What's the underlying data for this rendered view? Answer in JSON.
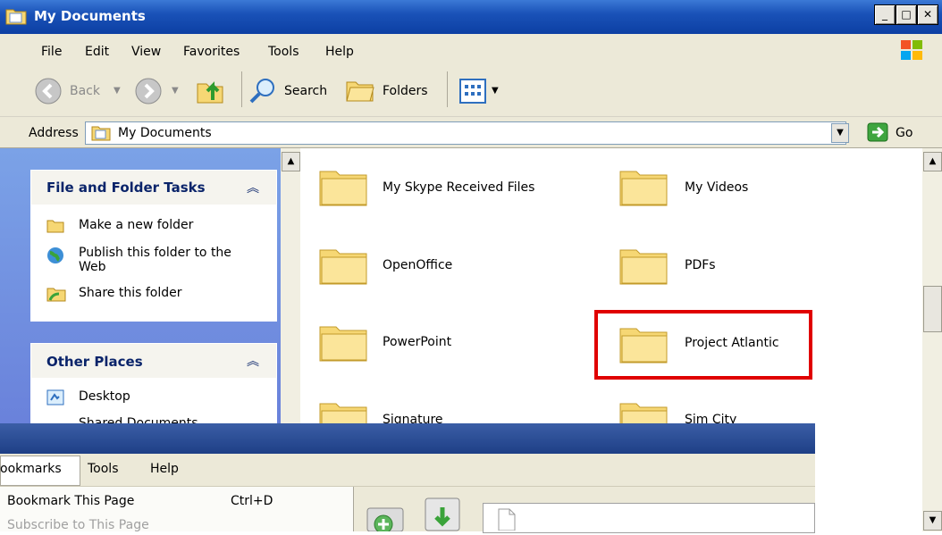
{
  "window": {
    "title": "My Documents",
    "minimize": "_",
    "maximize": "□",
    "close": "✕"
  },
  "menu": [
    "File",
    "Edit",
    "View",
    "Favorites",
    "Tools",
    "Help"
  ],
  "toolbar": {
    "back": "Back",
    "search": "Search",
    "folders": "Folders"
  },
  "address": {
    "label": "Address",
    "value": "My Documents",
    "go": "Go"
  },
  "left": {
    "tasks_title": "File and Folder Tasks",
    "tasks": [
      "Make a new folder",
      "Publish this folder to the Web",
      "Share this folder"
    ],
    "places_title": "Other Places",
    "places": [
      "Desktop",
      "Shared Documents"
    ]
  },
  "folders": [
    {
      "name": "My Skype Received Files"
    },
    {
      "name": "My Videos"
    },
    {
      "name": "OpenOffice"
    },
    {
      "name": "PDFs"
    },
    {
      "name": "PowerPoint"
    },
    {
      "name": "Project Atlantic"
    },
    {
      "name": "Signature"
    },
    {
      "name": "Sim City"
    }
  ],
  "second_window": {
    "menu": [
      "ookmarks",
      "Tools",
      "Help"
    ],
    "dropdown": [
      {
        "label": "Bookmark This Page",
        "shortcut": "Ctrl+D"
      },
      {
        "label": "Subscribe to This Page",
        "shortcut": ""
      }
    ]
  },
  "colors": {
    "title_blue": "#0c3fa3",
    "highlight_red": "#e00000",
    "folder_yellow": "#f6d774"
  }
}
